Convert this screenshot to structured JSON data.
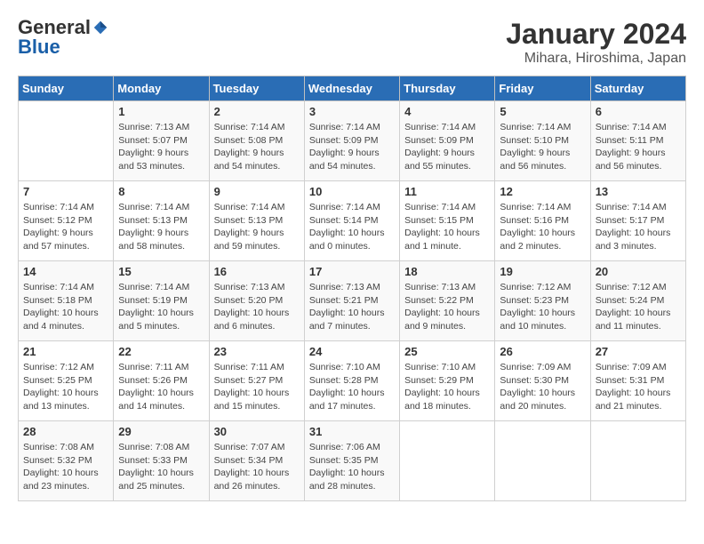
{
  "logo": {
    "general": "General",
    "blue": "Blue"
  },
  "title": "January 2024",
  "location": "Mihara, Hiroshima, Japan",
  "weekdays": [
    "Sunday",
    "Monday",
    "Tuesday",
    "Wednesday",
    "Thursday",
    "Friday",
    "Saturday"
  ],
  "weeks": [
    [
      {
        "day": "",
        "info": ""
      },
      {
        "day": "1",
        "info": "Sunrise: 7:13 AM\nSunset: 5:07 PM\nDaylight: 9 hours\nand 53 minutes."
      },
      {
        "day": "2",
        "info": "Sunrise: 7:14 AM\nSunset: 5:08 PM\nDaylight: 9 hours\nand 54 minutes."
      },
      {
        "day": "3",
        "info": "Sunrise: 7:14 AM\nSunset: 5:09 PM\nDaylight: 9 hours\nand 54 minutes."
      },
      {
        "day": "4",
        "info": "Sunrise: 7:14 AM\nSunset: 5:09 PM\nDaylight: 9 hours\nand 55 minutes."
      },
      {
        "day": "5",
        "info": "Sunrise: 7:14 AM\nSunset: 5:10 PM\nDaylight: 9 hours\nand 56 minutes."
      },
      {
        "day": "6",
        "info": "Sunrise: 7:14 AM\nSunset: 5:11 PM\nDaylight: 9 hours\nand 56 minutes."
      }
    ],
    [
      {
        "day": "7",
        "info": "Sunrise: 7:14 AM\nSunset: 5:12 PM\nDaylight: 9 hours\nand 57 minutes."
      },
      {
        "day": "8",
        "info": "Sunrise: 7:14 AM\nSunset: 5:13 PM\nDaylight: 9 hours\nand 58 minutes."
      },
      {
        "day": "9",
        "info": "Sunrise: 7:14 AM\nSunset: 5:13 PM\nDaylight: 9 hours\nand 59 minutes."
      },
      {
        "day": "10",
        "info": "Sunrise: 7:14 AM\nSunset: 5:14 PM\nDaylight: 10 hours\nand 0 minutes."
      },
      {
        "day": "11",
        "info": "Sunrise: 7:14 AM\nSunset: 5:15 PM\nDaylight: 10 hours\nand 1 minute."
      },
      {
        "day": "12",
        "info": "Sunrise: 7:14 AM\nSunset: 5:16 PM\nDaylight: 10 hours\nand 2 minutes."
      },
      {
        "day": "13",
        "info": "Sunrise: 7:14 AM\nSunset: 5:17 PM\nDaylight: 10 hours\nand 3 minutes."
      }
    ],
    [
      {
        "day": "14",
        "info": "Sunrise: 7:14 AM\nSunset: 5:18 PM\nDaylight: 10 hours\nand 4 minutes."
      },
      {
        "day": "15",
        "info": "Sunrise: 7:14 AM\nSunset: 5:19 PM\nDaylight: 10 hours\nand 5 minutes."
      },
      {
        "day": "16",
        "info": "Sunrise: 7:13 AM\nSunset: 5:20 PM\nDaylight: 10 hours\nand 6 minutes."
      },
      {
        "day": "17",
        "info": "Sunrise: 7:13 AM\nSunset: 5:21 PM\nDaylight: 10 hours\nand 7 minutes."
      },
      {
        "day": "18",
        "info": "Sunrise: 7:13 AM\nSunset: 5:22 PM\nDaylight: 10 hours\nand 9 minutes."
      },
      {
        "day": "19",
        "info": "Sunrise: 7:12 AM\nSunset: 5:23 PM\nDaylight: 10 hours\nand 10 minutes."
      },
      {
        "day": "20",
        "info": "Sunrise: 7:12 AM\nSunset: 5:24 PM\nDaylight: 10 hours\nand 11 minutes."
      }
    ],
    [
      {
        "day": "21",
        "info": "Sunrise: 7:12 AM\nSunset: 5:25 PM\nDaylight: 10 hours\nand 13 minutes."
      },
      {
        "day": "22",
        "info": "Sunrise: 7:11 AM\nSunset: 5:26 PM\nDaylight: 10 hours\nand 14 minutes."
      },
      {
        "day": "23",
        "info": "Sunrise: 7:11 AM\nSunset: 5:27 PM\nDaylight: 10 hours\nand 15 minutes."
      },
      {
        "day": "24",
        "info": "Sunrise: 7:10 AM\nSunset: 5:28 PM\nDaylight: 10 hours\nand 17 minutes."
      },
      {
        "day": "25",
        "info": "Sunrise: 7:10 AM\nSunset: 5:29 PM\nDaylight: 10 hours\nand 18 minutes."
      },
      {
        "day": "26",
        "info": "Sunrise: 7:09 AM\nSunset: 5:30 PM\nDaylight: 10 hours\nand 20 minutes."
      },
      {
        "day": "27",
        "info": "Sunrise: 7:09 AM\nSunset: 5:31 PM\nDaylight: 10 hours\nand 21 minutes."
      }
    ],
    [
      {
        "day": "28",
        "info": "Sunrise: 7:08 AM\nSunset: 5:32 PM\nDaylight: 10 hours\nand 23 minutes."
      },
      {
        "day": "29",
        "info": "Sunrise: 7:08 AM\nSunset: 5:33 PM\nDaylight: 10 hours\nand 25 minutes."
      },
      {
        "day": "30",
        "info": "Sunrise: 7:07 AM\nSunset: 5:34 PM\nDaylight: 10 hours\nand 26 minutes."
      },
      {
        "day": "31",
        "info": "Sunrise: 7:06 AM\nSunset: 5:35 PM\nDaylight: 10 hours\nand 28 minutes."
      },
      {
        "day": "",
        "info": ""
      },
      {
        "day": "",
        "info": ""
      },
      {
        "day": "",
        "info": ""
      }
    ]
  ]
}
